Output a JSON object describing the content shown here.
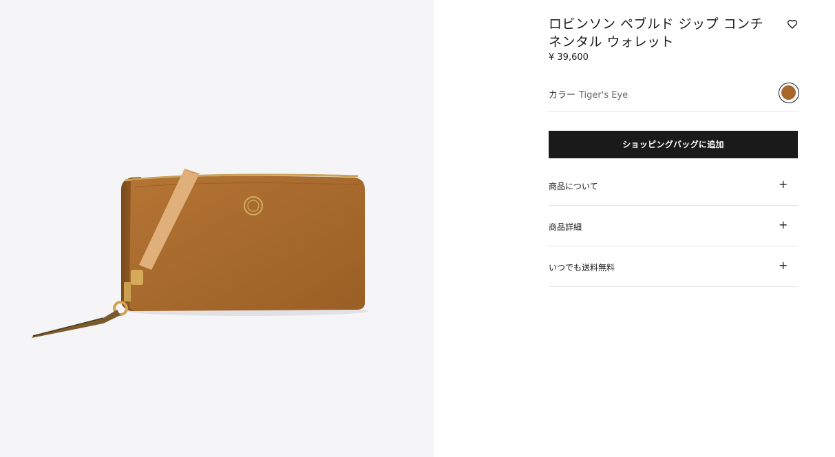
{
  "product": {
    "title": "ロビンソン ペブルド ジップ コンチネンタル ウォレット",
    "price": "¥ 39,600",
    "color_label": "カラー",
    "color_name": "Tiger's Eye",
    "swatch_color": "#a9682b",
    "image_alt": "Wallet"
  },
  "actions": {
    "add_to_bag": "ショッピングバッグに追加",
    "wishlist_icon": "heart-outline-icon"
  },
  "accordion": [
    {
      "label": "商品について",
      "icon": "plus-icon"
    },
    {
      "label": "商品詳細",
      "icon": "plus-icon"
    },
    {
      "label": "いつでも送料無料",
      "icon": "plus-icon"
    }
  ]
}
